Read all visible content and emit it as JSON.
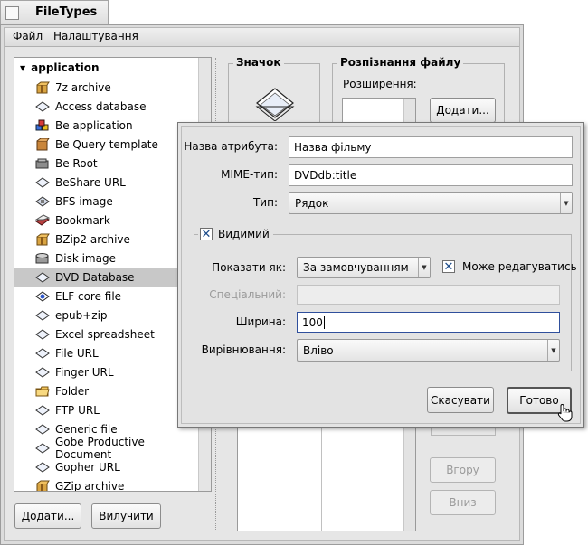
{
  "window": {
    "title": "FileTypes"
  },
  "menubar": {
    "items": [
      "Файл",
      "Налаштування"
    ]
  },
  "tree": {
    "root": "application",
    "selected_index": 10,
    "items": [
      {
        "label": "7z archive",
        "icon": "archive-icon"
      },
      {
        "label": "Access database",
        "icon": "generic-file-icon"
      },
      {
        "label": "Be application",
        "icon": "be-app-icon"
      },
      {
        "label": "Be Query template",
        "icon": "query-template-icon"
      },
      {
        "label": "Be Root",
        "icon": "be-root-icon"
      },
      {
        "label": "BeShare URL",
        "icon": "generic-file-icon"
      },
      {
        "label": "BFS image",
        "icon": "bfs-image-icon"
      },
      {
        "label": "Bookmark",
        "icon": "bookmark-icon"
      },
      {
        "label": "BZip2 archive",
        "icon": "archive-icon"
      },
      {
        "label": "Disk image",
        "icon": "disk-image-icon"
      },
      {
        "label": "DVD Database",
        "icon": "generic-file-icon"
      },
      {
        "label": "ELF core file",
        "icon": "elf-core-icon"
      },
      {
        "label": "epub+zip",
        "icon": "generic-file-icon"
      },
      {
        "label": "Excel spreadsheet",
        "icon": "generic-file-icon"
      },
      {
        "label": "File URL",
        "icon": "generic-file-icon"
      },
      {
        "label": "Finger URL",
        "icon": "generic-file-icon"
      },
      {
        "label": "Folder",
        "icon": "folder-icon"
      },
      {
        "label": "FTP URL",
        "icon": "generic-file-icon"
      },
      {
        "label": "Generic file",
        "icon": "generic-file-icon"
      },
      {
        "label": "Gobe Productive Document",
        "icon": "generic-file-icon"
      },
      {
        "label": "Gopher URL",
        "icon": "generic-file-icon"
      },
      {
        "label": "GZip archive",
        "icon": "archive-icon"
      }
    ]
  },
  "left_buttons": {
    "add": "Додати...",
    "remove": "Вилучити"
  },
  "icon_box": {
    "title": "Значок"
  },
  "recognition": {
    "title": "Розпізнання файлу",
    "extensions_label": "Розширення:",
    "add_button": "Додати..."
  },
  "right_buttons": {
    "up": "Вгору",
    "down": "Вниз"
  },
  "dialog": {
    "attr_name_label": "Назва атрибута:",
    "attr_name_value": "Назва фільму",
    "mime_label": "MIME-тип:",
    "mime_value": "DVDdb:title",
    "type_label": "Тип:",
    "type_value": "Рядок",
    "visible_label": "Видимий",
    "visible_checked": "✕",
    "show_as_label": "Показати як:",
    "show_as_value": "За замовчуванням",
    "editable_label": "Може редагуватись",
    "editable_checked": "✕",
    "special_label": "Спеціальний:",
    "width_label": "Ширина:",
    "width_value": "100",
    "align_label": "Вирівнювання:",
    "align_value": "Вліво",
    "cancel": "Скасувати",
    "done": "Готово"
  }
}
